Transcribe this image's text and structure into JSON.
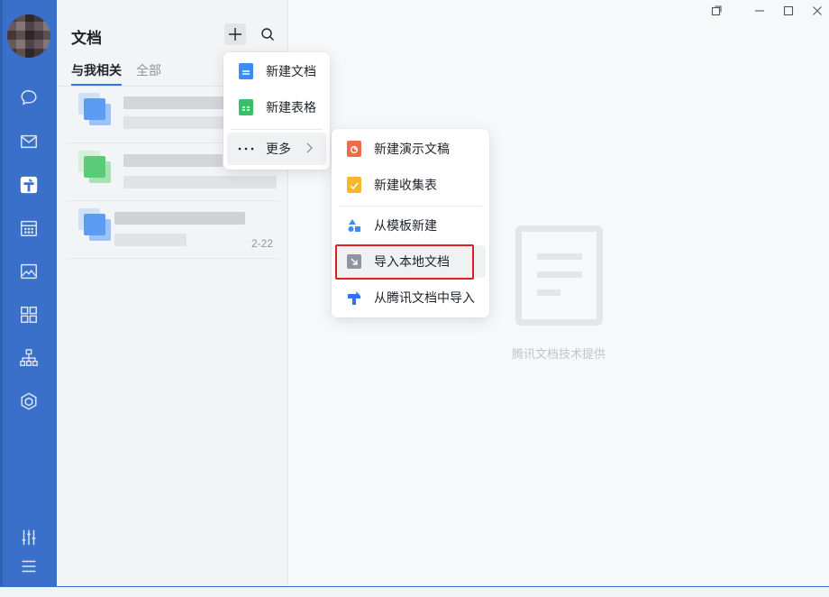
{
  "rail": {
    "icons": [
      "chat-icon",
      "mail-icon",
      "docs-icon",
      "calendar-icon",
      "photo-icon",
      "apps-icon",
      "org-icon",
      "cube-icon",
      "settings-sliders-icon",
      "menu-icon"
    ]
  },
  "panel": {
    "title": "文档",
    "tabs": [
      {
        "label": "与我相关",
        "active": true
      },
      {
        "label": "全部",
        "active": false
      }
    ],
    "items": [
      {
        "icon_color": "#5b9bf2",
        "date": ""
      },
      {
        "icon_color": "#5ccb78",
        "date": ""
      },
      {
        "icon_color": "#5b9bf2",
        "date": "2-22"
      }
    ]
  },
  "new_menu": {
    "items": [
      {
        "label": "新建文档",
        "icon": "doc-icon",
        "color": "#3c8cf7"
      },
      {
        "label": "新建表格",
        "icon": "sheet-icon",
        "color": "#3bbf66"
      },
      {
        "label": "更多",
        "icon": "ellipsis-icon",
        "color": "#1f2329"
      }
    ]
  },
  "more_menu": {
    "items": [
      {
        "label": "新建演示文稿",
        "icon": "slides-icon",
        "color": "#f06b4a"
      },
      {
        "label": "新建收集表",
        "icon": "form-icon",
        "color": "#f5b72b"
      },
      {
        "label": "从模板新建",
        "icon": "template-icon",
        "color": "#3c8cf7"
      },
      {
        "label": "导入本地文档",
        "icon": "import-icon",
        "color": "#8f959e"
      },
      {
        "label": "从腾讯文档中导入",
        "icon": "tencent-docs-icon",
        "color": "#2f74f0"
      }
    ]
  },
  "main": {
    "powered_by": "腾讯文档技术提供"
  },
  "colors": {
    "rail": "#3a70c9",
    "accent": "#3370ff",
    "highlight": "#e02020"
  }
}
